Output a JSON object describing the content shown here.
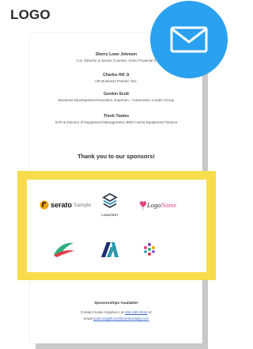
{
  "header": {
    "logo": "LOGO"
  },
  "people": [
    {
      "name": "Sherry Lowe Johnson",
      "title": "U.S. Director & Senior Counsel, Volvo Financial S"
    },
    {
      "name": "Charles Hill Jr",
      "title": "HR Business Partner, DLL"
    },
    {
      "name": "Gordon Scott",
      "title": "Business Development Executive, Experian – Automotive Lender Group"
    },
    {
      "name": "Thorb Towles",
      "title": "SVP & Director of Equipment Management, BMO Harris Equipment Finance"
    }
  ],
  "thanks": "Thank you to our sponsors!",
  "sponsors": {
    "serato": {
      "brand": "serato",
      "suffix": "Sample"
    },
    "logotext": {
      "label": "LOGOTEXT"
    },
    "logoname": {
      "prefix": "Logo",
      "accent": "Name"
    }
  },
  "footer": {
    "heading": "Sponsorships Available!",
    "contact_prefix": "Contact Susie Angelucci at",
    "phone": "484-459-3016",
    "contact_or": "or",
    "email_label": "email",
    "email": "susie.angelucci@monitordaily.com"
  },
  "badge": {
    "icon": "envelope-icon",
    "color": "#2aa1ee"
  },
  "colors": {
    "sponsor_frame": "#f7dd4b",
    "link": "#3468c9"
  }
}
